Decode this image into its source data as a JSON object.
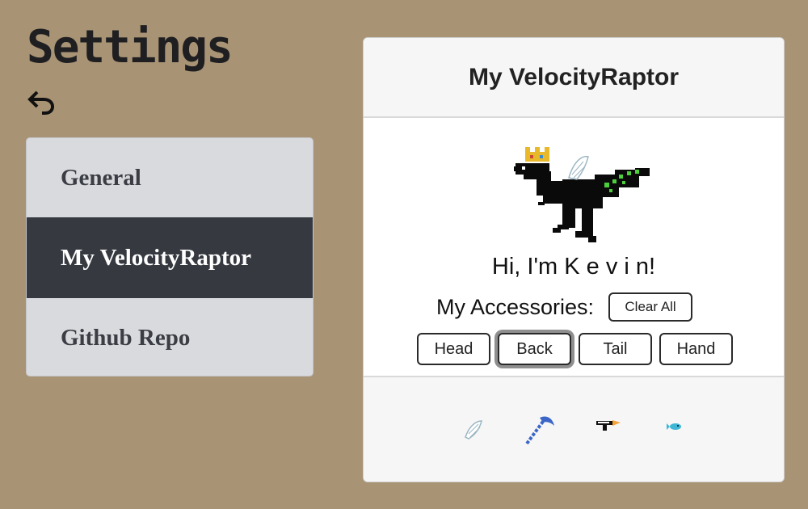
{
  "page": {
    "title": "Settings"
  },
  "menu": {
    "items": [
      {
        "label": "General",
        "active": false
      },
      {
        "label": "My VelocityRaptor",
        "active": true
      },
      {
        "label": "Github Repo",
        "active": false
      }
    ]
  },
  "card": {
    "title": "My VelocityRaptor",
    "greeting": "Hi, I'm K e v i n!",
    "accessories_label": "My Accessories:",
    "clear_all_label": "Clear All",
    "tabs": [
      {
        "label": "Head",
        "selected": false
      },
      {
        "label": "Back",
        "selected": true
      },
      {
        "label": "Tail",
        "selected": false
      },
      {
        "label": "Hand",
        "selected": false
      }
    ],
    "accessory_icons": [
      "wing-icon",
      "scythe-icon",
      "gun-icon",
      "fish-icon"
    ]
  },
  "colors": {
    "background": "#a89374",
    "menu_active": "#363a40",
    "menu_inactive": "#d9dadd"
  }
}
